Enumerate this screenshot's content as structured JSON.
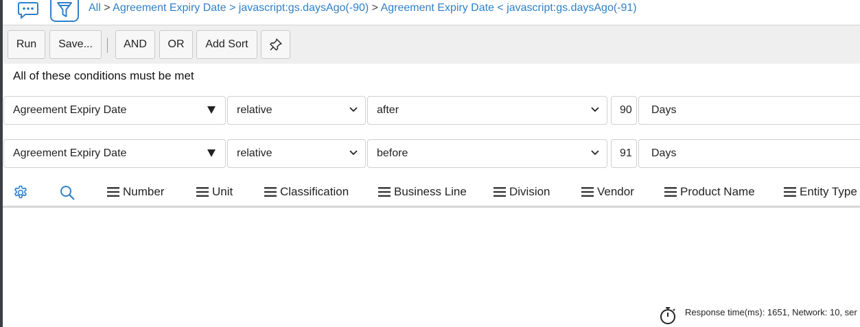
{
  "breadcrumb": {
    "root": "All",
    "sep1": ">",
    "crumb1": "Agreement Expiry Date > javascript:gs.daysAgo(-90)",
    "sep2": ">",
    "crumb2": "Agreement Expiry Date < javascript:gs.daysAgo(-91)"
  },
  "toolbar": {
    "run": "Run",
    "save": "Save...",
    "and": "AND",
    "or": "OR",
    "add_sort": "Add Sort"
  },
  "conditions": {
    "title": "All of these conditions must be met",
    "rows": [
      {
        "field": "Agreement Expiry Date",
        "mode": "relative",
        "operator": "after",
        "value": "90",
        "unit": "Days"
      },
      {
        "field": "Agreement Expiry Date",
        "mode": "relative",
        "operator": "before",
        "value": "91",
        "unit": "Days"
      }
    ]
  },
  "columns": [
    "Number",
    "Unit",
    "Classification",
    "Business Line",
    "Division",
    "Vendor",
    "Product Name",
    "Entity Type"
  ],
  "footer": {
    "response": "Response time(ms): 1651, Network: 10, ser"
  },
  "colors": {
    "accent": "#2e80c9",
    "toolbar_bg": "#efefef"
  },
  "icons": {
    "chat": "chat-icon",
    "filter": "filter-icon",
    "settings": "gear-icon",
    "search": "search-icon",
    "stopwatch": "stopwatch-icon",
    "pin": "pin-icon"
  }
}
